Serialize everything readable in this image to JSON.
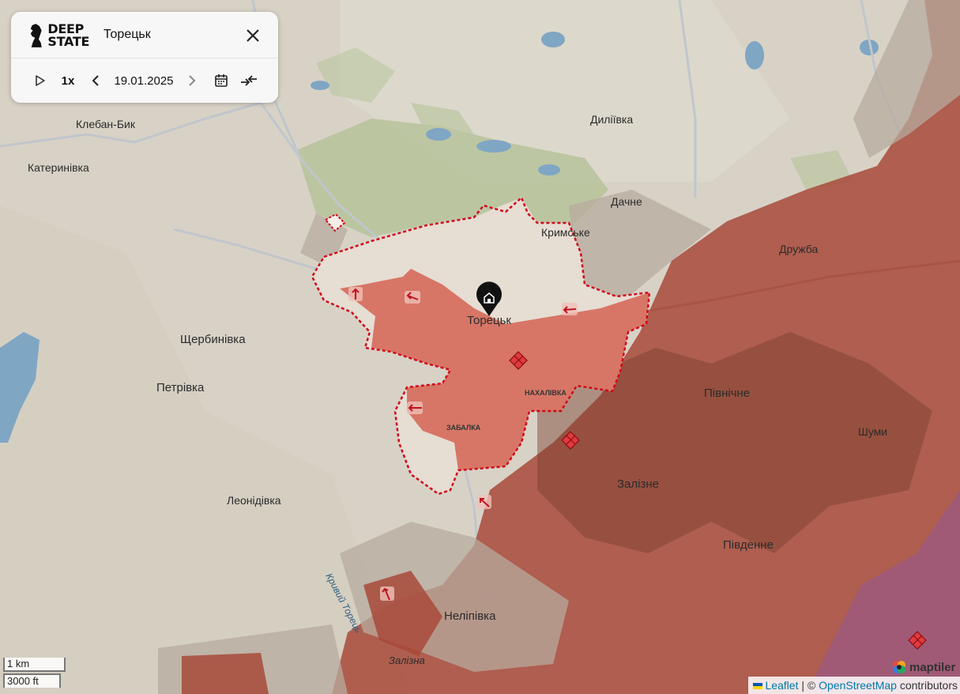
{
  "panel": {
    "brand": "DEEP STATE",
    "title": "Торецьк",
    "speed": "1x",
    "date": "19.01.2025"
  },
  "places": {
    "kleban_byk": "Клебан-Бик",
    "katerynivka": "Катеринівка",
    "shcherbynivka": "Щербинівка",
    "petrivka": "Петрівка",
    "leonidivka": "Леонідівка",
    "dyliivka": "Диліївка",
    "dachne": "Дачне",
    "krymske": "Кримське",
    "druzhba": "Дружба",
    "toretsk": "Торецьк",
    "nakhalivka": "НАХАЛІВКА",
    "zabalka": "ЗАБАЛКА",
    "pivnichne": "Північне",
    "shumy": "Шуми",
    "zalizne": "Залізне",
    "pivdenne": "Південне",
    "nelipivka": "Неліпівка",
    "kryvyi_torets": "Кривий Торець",
    "zalizna": "Залізна"
  },
  "scale": {
    "metric": "1 km",
    "imperial": "3000 ft"
  },
  "attribution": {
    "leaflet": "Leaflet",
    "separator": " | © ",
    "osm": "OpenStreetMap",
    "contributors": " contributors"
  },
  "maptiler": "maptiler",
  "colors": {
    "occupied": "#a84a3a",
    "contested": "#d56a5a",
    "grey_zone": "#b9aea3",
    "city_fill": "#e6ddd3",
    "water": "#7ea7c4",
    "green": "#b9c6a0",
    "border_dash": "#d0091b",
    "other_zone": "#9b5a84"
  }
}
